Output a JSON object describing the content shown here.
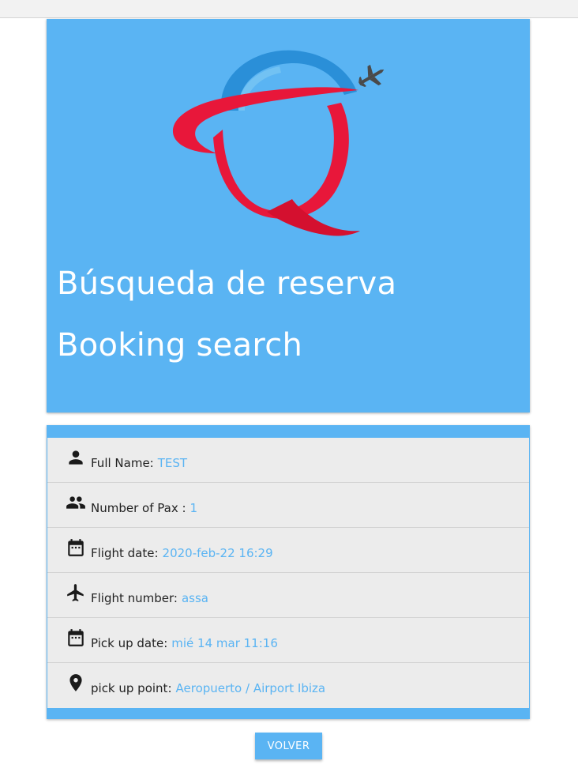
{
  "header": {
    "title_es": "Búsqueda de reserva",
    "title_en": "Booking search",
    "logo_icon": "airline-logo-q-plane"
  },
  "booking": {
    "rows": [
      {
        "icon": "person-icon",
        "label": "Full Name:",
        "value": "TEST"
      },
      {
        "icon": "group-icon",
        "label": "Number of Pax :",
        "value": "1"
      },
      {
        "icon": "calendar-icon",
        "label": "Flight date:",
        "value": "2020-feb-22 16:29"
      },
      {
        "icon": "airplane-icon",
        "label": "Flight number:",
        "value": "assa"
      },
      {
        "icon": "calendar-icon",
        "label": "Pick up date:",
        "value": "mié 14 mar 11:16"
      },
      {
        "icon": "location-pin-icon",
        "label": "pick up point:",
        "value": "Aeropuerto / Airport Ibiza"
      }
    ]
  },
  "actions": {
    "back_label": "VOLVER"
  },
  "colors": {
    "accent": "#5ab4f3",
    "logo_red": "#e8173a",
    "logo_blue": "#2a8fd8"
  }
}
